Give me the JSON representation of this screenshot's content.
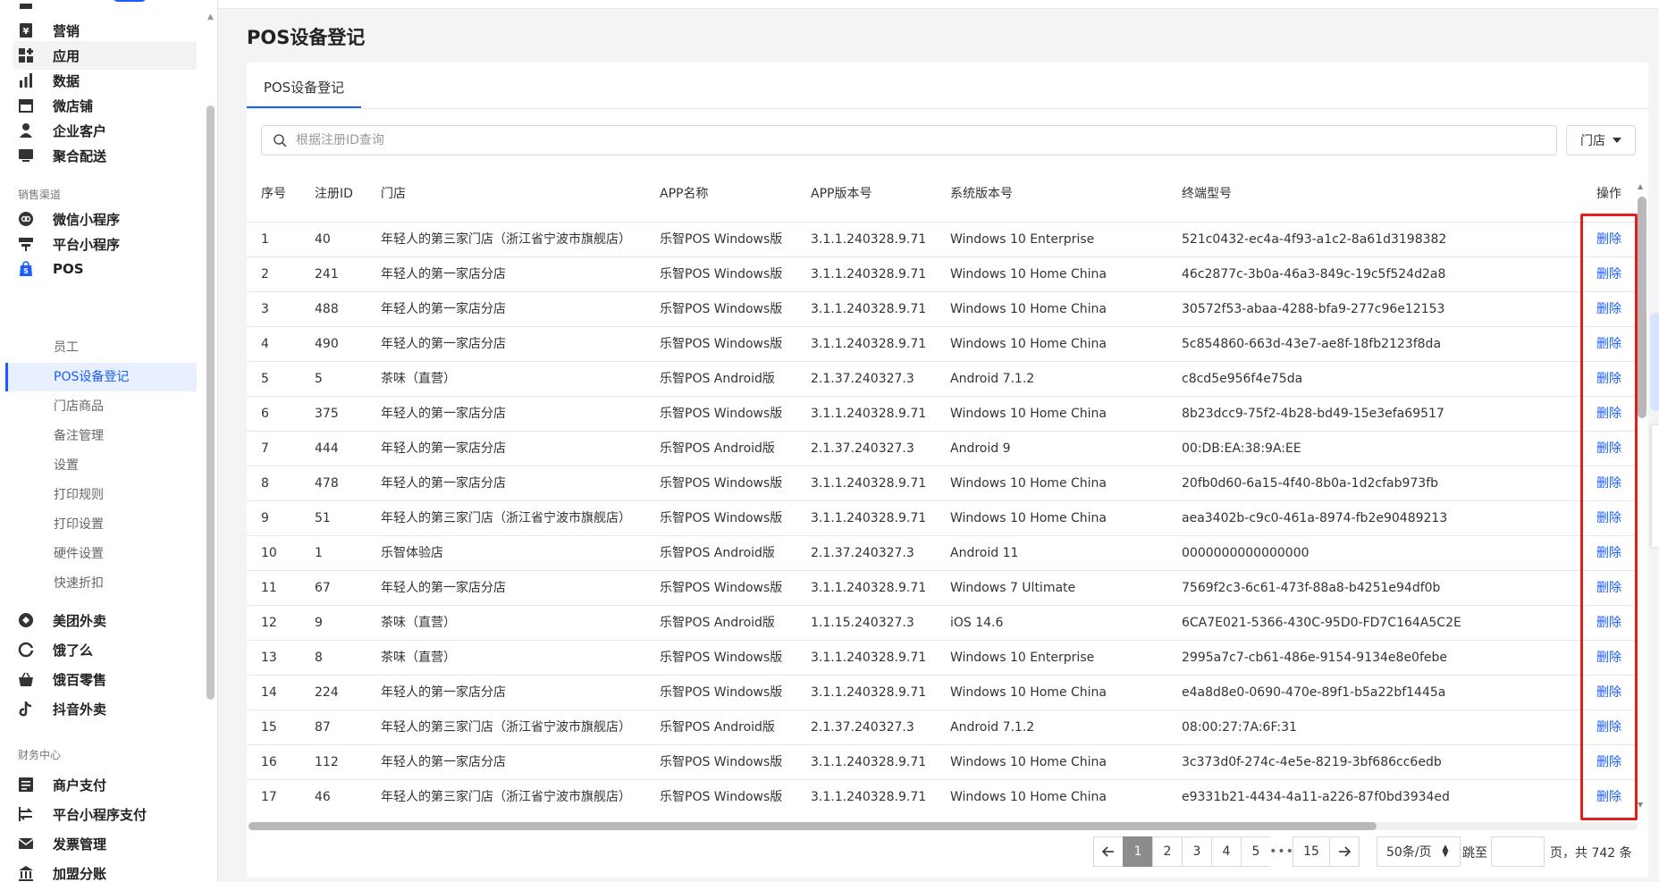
{
  "sidebar": {
    "top_items": [
      {
        "label": "营销",
        "icon": "marketing-icon"
      },
      {
        "label": "应用",
        "icon": "apps-icon"
      },
      {
        "label": "数据",
        "icon": "data-chart-icon"
      },
      {
        "label": "微店铺",
        "icon": "store-icon"
      },
      {
        "label": "企业客户",
        "icon": "customer-icon"
      },
      {
        "label": "聚合配送",
        "icon": "delivery-icon"
      }
    ],
    "sales_channel_title": "销售渠道",
    "channel_items": [
      {
        "label": "微信小程序",
        "icon": "wechat-miniapp-icon"
      },
      {
        "label": "平台小程序",
        "icon": "platform-miniapp-icon"
      },
      {
        "label": "POS",
        "icon": "pos-bag-icon"
      }
    ],
    "pos_sub_items": [
      "员工",
      "POS设备登记",
      "门店商品",
      "备注管理",
      "设置",
      "打印规则",
      "打印设置",
      "硬件设置",
      "快速折扣"
    ],
    "delivery_items": [
      {
        "label": "美团外卖",
        "icon": "meituan-icon"
      },
      {
        "label": "饿了么",
        "icon": "eleme-icon"
      },
      {
        "label": "饿百零售",
        "icon": "ebai-basket-icon"
      },
      {
        "label": "抖音外卖",
        "icon": "douyin-icon"
      }
    ],
    "finance_title": "财务中心",
    "finance_items": [
      {
        "label": "商户支付",
        "icon": "merchant-pay-icon"
      },
      {
        "label": "平台小程序支付",
        "icon": "platform-pay-icon"
      },
      {
        "label": "发票管理",
        "icon": "invoice-icon"
      },
      {
        "label": "加盟分账",
        "icon": "franchise-icon"
      }
    ]
  },
  "page": {
    "title": "POS设备登记",
    "tab": "POS设备登记",
    "search_placeholder": "根据注册ID查询",
    "store_filter": "门店"
  },
  "table": {
    "headers": [
      "序号",
      "注册ID",
      "门店",
      "APP名称",
      "APP版本号",
      "系统版本号",
      "终端型号",
      "操作"
    ],
    "action_label": "删除",
    "rows": [
      [
        "1",
        "40",
        "年轻人的第三家门店（浙江省宁波市旗舰店）",
        "乐智POS Windows版",
        "3.1.1.240328.9.71",
        "Windows 10 Enterprise",
        "521c0432-ec4a-4f93-a1c2-8a61d3198382"
      ],
      [
        "2",
        "241",
        "年轻人的第一家店分店",
        "乐智POS Windows版",
        "3.1.1.240328.9.71",
        "Windows 10 Home China",
        "46c2877c-3b0a-46a3-849c-19c5f524d2a8"
      ],
      [
        "3",
        "488",
        "年轻人的第一家店分店",
        "乐智POS Windows版",
        "3.1.1.240328.9.71",
        "Windows 10 Home China",
        "30572f53-abaa-4288-bfa9-277c96e12153"
      ],
      [
        "4",
        "490",
        "年轻人的第一家店分店",
        "乐智POS Windows版",
        "3.1.1.240328.9.71",
        "Windows 10 Home China",
        "5c854860-663d-43e7-ae8f-18fb2123f8da"
      ],
      [
        "5",
        "5",
        "茶味（直营）",
        "乐智POS Android版",
        "2.1.37.240327.3",
        "Android 7.1.2",
        "c8cd5e956f4e75da"
      ],
      [
        "6",
        "375",
        "年轻人的第一家店分店",
        "乐智POS Windows版",
        "3.1.1.240328.9.71",
        "Windows 10 Home China",
        "8b23dcc9-75f2-4b28-bd49-15e3efa69517"
      ],
      [
        "7",
        "444",
        "年轻人的第一家店分店",
        "乐智POS Android版",
        "2.1.37.240327.3",
        "Android 9",
        "00:DB:EA:38:9A:EE"
      ],
      [
        "8",
        "478",
        "年轻人的第一家店分店",
        "乐智POS Windows版",
        "3.1.1.240328.9.71",
        "Windows 10 Home China",
        "20fb0d60-6a15-4f40-8b0a-1d2cfab973fb"
      ],
      [
        "9",
        "51",
        "年轻人的第三家门店（浙江省宁波市旗舰店）",
        "乐智POS Windows版",
        "3.1.1.240328.9.71",
        "Windows 10 Home China",
        "aea3402b-c9c0-461a-8974-fb2e90489213"
      ],
      [
        "10",
        "1",
        "乐智体验店",
        "乐智POS Android版",
        "2.1.37.240327.3",
        "Android 11",
        "0000000000000000"
      ],
      [
        "11",
        "67",
        "年轻人的第一家店分店",
        "乐智POS Windows版",
        "3.1.1.240328.9.71",
        "Windows 7 Ultimate",
        "7569f2c3-6c61-473f-88a8-b4251e94df0b"
      ],
      [
        "12",
        "9",
        "茶味（直营）",
        "乐智POS Android版",
        "1.1.15.240327.3",
        "iOS 14.6",
        "6CA7E021-5366-430C-95D0-FD7C164A5C2E"
      ],
      [
        "13",
        "8",
        "茶味（直营）",
        "乐智POS Windows版",
        "3.1.1.240328.9.71",
        "Windows 10 Enterprise",
        "2995a7c7-cb61-486e-9154-9134e8e0febe"
      ],
      [
        "14",
        "224",
        "年轻人的第一家店分店",
        "乐智POS Windows版",
        "3.1.1.240328.9.71",
        "Windows 10 Home China",
        "e4a8d8e0-0690-470e-89f1-b5a22bf1445a"
      ],
      [
        "15",
        "87",
        "年轻人的第三家门店（浙江省宁波市旗舰店）",
        "乐智POS Android版",
        "2.1.37.240327.3",
        "Android 7.1.2",
        "08:00:27:7A:6F:31"
      ],
      [
        "16",
        "112",
        "年轻人的第一家店分店",
        "乐智POS Windows版",
        "3.1.1.240328.9.71",
        "Windows 10 Home China",
        "3c373d0f-274c-4e5e-8219-3bf686cc6edb"
      ],
      [
        "17",
        "46",
        "年轻人的第三家门店（浙江省宁波市旗舰店）",
        "乐智POS Windows版",
        "3.1.1.240328.9.71",
        "Windows 10 Home China",
        "e9331b21-4434-4a11-a226-87f0bd3934ed"
      ]
    ]
  },
  "pagination": {
    "pages": [
      "1",
      "2",
      "3",
      "4",
      "5"
    ],
    "dots": "•••",
    "last_page": "15",
    "current_page": "1",
    "page_size": "50条/页",
    "jump_label": "跳至",
    "total_text": "页，共 742 条"
  },
  "colors": {
    "accent": "#1a5cff",
    "highlight_border": "#e0201b"
  }
}
